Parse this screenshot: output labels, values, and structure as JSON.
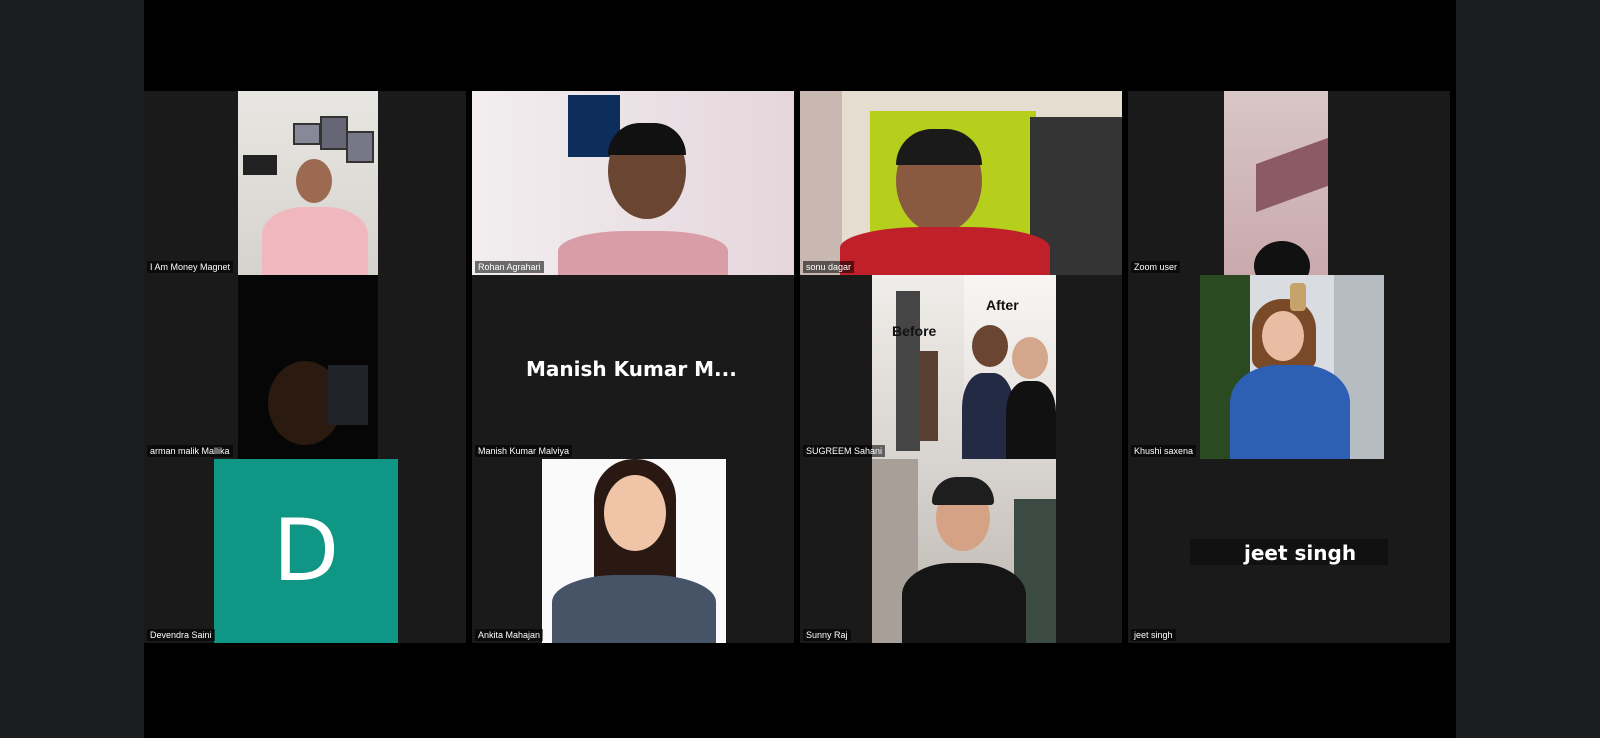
{
  "meeting": {
    "participants": [
      {
        "name": "I Am Money Magnet"
      },
      {
        "name": "Rohan Agrahari"
      },
      {
        "name": "sonu dagar"
      },
      {
        "name": "Zoom user"
      },
      {
        "name": "arman malik Mallika"
      },
      {
        "name": "Manish Kumar Malviya",
        "placeholder": "Manish  Kumar  M..."
      },
      {
        "name": "SUGREEM Sahani",
        "overlay_before": "Before",
        "overlay_after": "After"
      },
      {
        "name": "Khushi saxena"
      },
      {
        "name": "Devendra Saini",
        "avatar_letter": "D"
      },
      {
        "name": "Ankita Mahajan"
      },
      {
        "name": "Sunny Raj"
      },
      {
        "name": "jeet singh",
        "placeholder": "jeet singh"
      }
    ]
  },
  "colors": {
    "tile_bg": "#1a1a1a",
    "stage_bg": "#000000",
    "outer_bg": "#1c1d20",
    "avatar_teal": "#0f9684"
  }
}
